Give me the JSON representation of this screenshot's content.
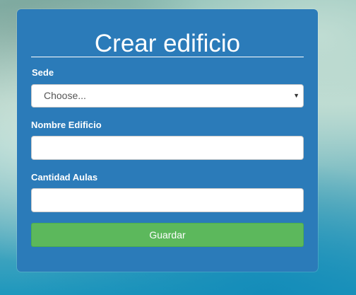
{
  "form": {
    "title": "Crear edificio",
    "sede": {
      "label": "Sede",
      "selected": "Choose...",
      "arrow_icon": "caret-down-icon"
    },
    "nombre_edificio": {
      "label": "Nombre Edificio",
      "value": "",
      "placeholder": ""
    },
    "cantidad_aulas": {
      "label": "Cantidad Aulas",
      "value": "",
      "placeholder": ""
    },
    "submit_label": "Guardar"
  },
  "colors": {
    "card_background": "#2b7bb9",
    "button_background": "#5cb85c",
    "text": "#ffffff"
  }
}
